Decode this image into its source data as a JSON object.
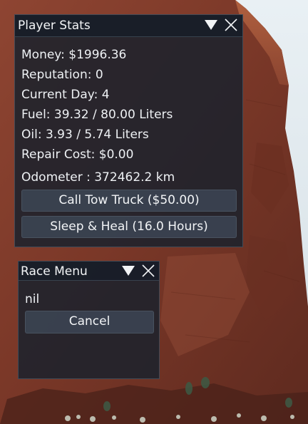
{
  "player_stats": {
    "title": "Player Stats",
    "money": "Money: $1996.36",
    "reputation": "Reputation: 0",
    "current_day": "Current Day: 4",
    "fuel": "Fuel: 39.32 / 80.00 Liters",
    "oil": "Oil: 3.93 / 5.74 Liters",
    "repair_cost": "Repair Cost: $0.00",
    "odometer": "Odometer : 372462.2 km",
    "tow_button": "Call Tow Truck ($50.00)",
    "sleep_button": "Sleep & Heal (16.0 Hours)"
  },
  "race_menu": {
    "title": "Race Menu",
    "status": "nil",
    "cancel_button": "Cancel"
  },
  "icons": {
    "collapse": "triangle-down-icon",
    "close": "close-x-icon"
  },
  "colors": {
    "panel_bg": "#1c222c",
    "button_bg": "#3a4250",
    "text": "#eef1f4",
    "rock": "#7a3a29"
  }
}
